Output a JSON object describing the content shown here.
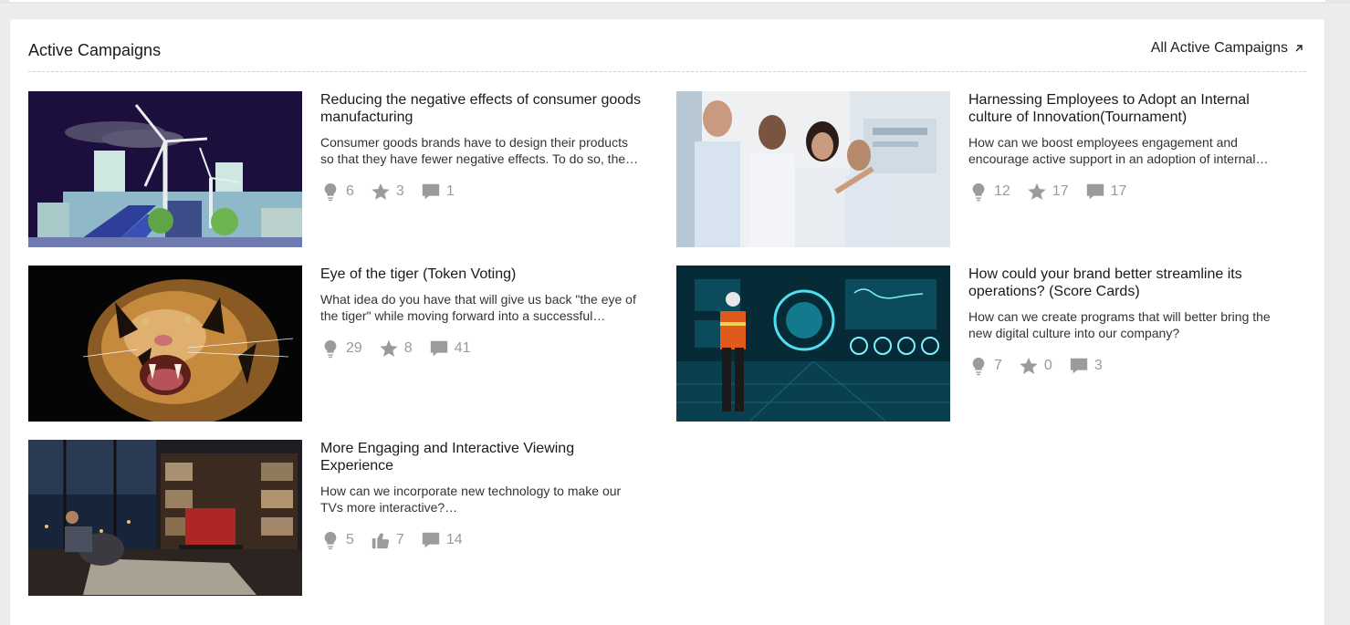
{
  "panel": {
    "title": "Active Campaigns",
    "all_link_label": "All Active Campaigns"
  },
  "campaigns": [
    {
      "title": "Reducing the negative effects of consumer goods manufacturing",
      "description": "Consumer goods brands have to design their products so that they have fewer negative effects. To do so, the…",
      "image_icon": "wind-turbine-city-illustration",
      "stats": [
        {
          "icon": "lightbulb-icon",
          "value": "6"
        },
        {
          "icon": "star-icon",
          "value": "3"
        },
        {
          "icon": "comment-icon",
          "value": "1"
        }
      ]
    },
    {
      "title": "Harnessing Employees to Adopt an Internal culture of Innovation(Tournament)",
      "description": "How can we boost employees engagement and encourage active support in an adoption of internal…",
      "image_icon": "team-touchscreen-photo",
      "stats": [
        {
          "icon": "lightbulb-icon",
          "value": "12"
        },
        {
          "icon": "star-icon",
          "value": "17"
        },
        {
          "icon": "comment-icon",
          "value": "17"
        }
      ]
    },
    {
      "title": "Eye of the tiger (Token Voting)",
      "description": "What idea do you have that will give us back \"the eye of the tiger\" while moving forward into a successful…",
      "image_icon": "tiger-photo",
      "stats": [
        {
          "icon": "lightbulb-icon",
          "value": "29"
        },
        {
          "icon": "star-icon",
          "value": "8"
        },
        {
          "icon": "comment-icon",
          "value": "41"
        }
      ]
    },
    {
      "title": "How could your brand better streamline its operations? (Score Cards)",
      "description": "How can we create programs that will better bring the new digital culture into our company?",
      "image_icon": "digital-dashboard-worker-photo",
      "stats": [
        {
          "icon": "lightbulb-icon",
          "value": "7"
        },
        {
          "icon": "star-icon",
          "value": "0"
        },
        {
          "icon": "comment-icon",
          "value": "3"
        }
      ]
    },
    {
      "title": "More Engaging and Interactive Viewing Experience",
      "description": "How can we incorporate new technology to make our TVs more interactive?…",
      "image_icon": "living-room-tv-photo",
      "stats": [
        {
          "icon": "lightbulb-icon",
          "value": "5"
        },
        {
          "icon": "thumbs-up-icon",
          "value": "7"
        },
        {
          "icon": "comment-icon",
          "value": "14"
        }
      ]
    }
  ]
}
